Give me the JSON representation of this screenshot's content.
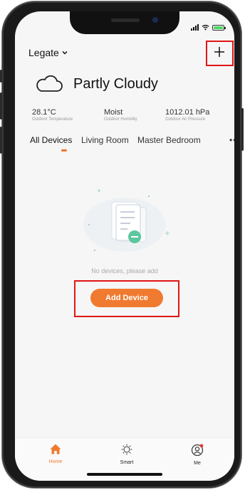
{
  "header": {
    "home_name": "Legate",
    "add_icon": "plus-icon"
  },
  "weather": {
    "title": "Partly Cloudy",
    "icon": "cloud-icon",
    "metrics": [
      {
        "value": "28.1°C",
        "label": "Outdoor Temperature"
      },
      {
        "value": "Moist",
        "label": "Outdoor Humidity"
      },
      {
        "value": "1012.01 hPa",
        "label": "Outdoor Air Pressure"
      }
    ]
  },
  "tabs": [
    "All Devices",
    "Living Room",
    "Master Bedroom"
  ],
  "empty": {
    "text": "No devices, please add",
    "button": "Add Device"
  },
  "tabbar": [
    {
      "label": "Home",
      "icon": "home-icon"
    },
    {
      "label": "Smart",
      "icon": "sun-icon"
    },
    {
      "label": "Me",
      "icon": "user-icon"
    }
  ],
  "colors": {
    "accent": "#f07a2f",
    "highlight": "#e01515"
  }
}
